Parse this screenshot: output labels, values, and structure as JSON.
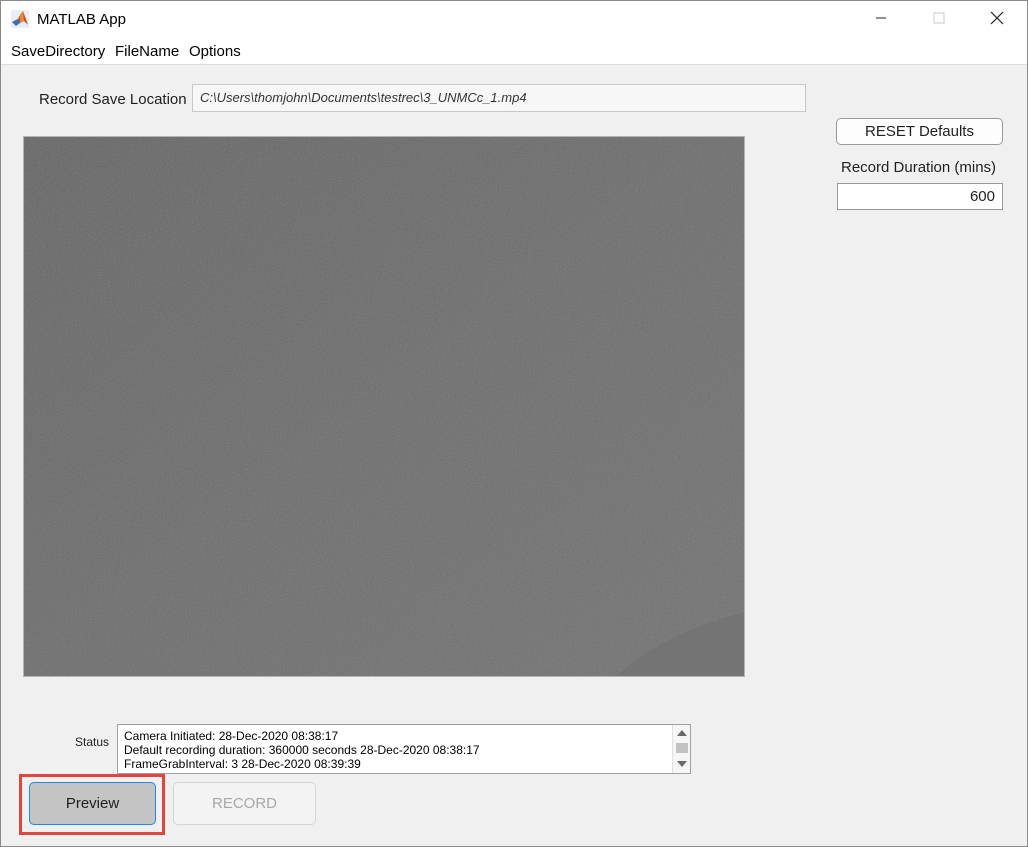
{
  "window": {
    "title": "MATLAB App",
    "controls": [
      "minimize-icon",
      "maximize-icon",
      "close-icon"
    ]
  },
  "menu": {
    "items": [
      "SaveDirectory",
      "FileName",
      "Options"
    ]
  },
  "record": {
    "save_location_label": "Record Save Location",
    "save_location_value": "C:\\Users\\thomjohn\\Documents\\testrec\\3_UNMCc_1.mp4",
    "reset_label": "RESET Defaults",
    "duration_label": "Record Duration (mins)",
    "duration_value": "600"
  },
  "status": {
    "label": "Status",
    "lines": [
      "Camera Initiated: 28-Dec-2020 08:38:17",
      "Default recording duration: 360000 seconds 28-Dec-2020 08:38:17",
      "FrameGrabInterval: 3 28-Dec-2020 08:39:39"
    ]
  },
  "buttons": {
    "preview": "Preview",
    "record": "RECORD"
  },
  "colors": {
    "highlight": "#e0463f",
    "focus_border": "#1e88e5",
    "camera_gray": "#6b6b6b"
  }
}
